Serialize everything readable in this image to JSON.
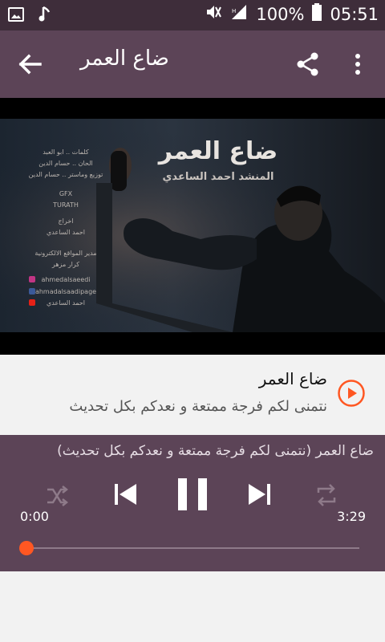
{
  "status": {
    "battery_percent": "100%",
    "time": "05:51"
  },
  "toolbar": {
    "title": "ضاع العمر"
  },
  "video": {
    "title_art": "ضاع العمر",
    "subtitle_art": "المنشد احمد الساعدي",
    "credits": [
      "كلمات .. ابو العبد",
      "الحان .. حسام الدين",
      "توزيع وماستر .. حسام الدين",
      "GFX",
      "TURATH",
      "اخراج",
      "احمد الساعدي",
      "مدير المواقع الالكترونية",
      "كرار مزهر",
      "ahmedalsaeedi",
      "ahmadalsaadipage",
      "احمد الساعدي"
    ]
  },
  "song": {
    "name": "ضاع العمر",
    "description": "نتمنى لكم فرجة ممتعة و نعدكم بكل تحديث"
  },
  "player": {
    "track_text": "ضاع العمر (نتمنى لكم فرجة ممتعة و نعدكم بكل تحديث)",
    "time_current": "0:00",
    "time_total": "3:29",
    "progress": 0
  },
  "colors": {
    "accent": "#ff5722",
    "toolbar": "#5c4457",
    "statusbar": "#3e2d3a"
  }
}
